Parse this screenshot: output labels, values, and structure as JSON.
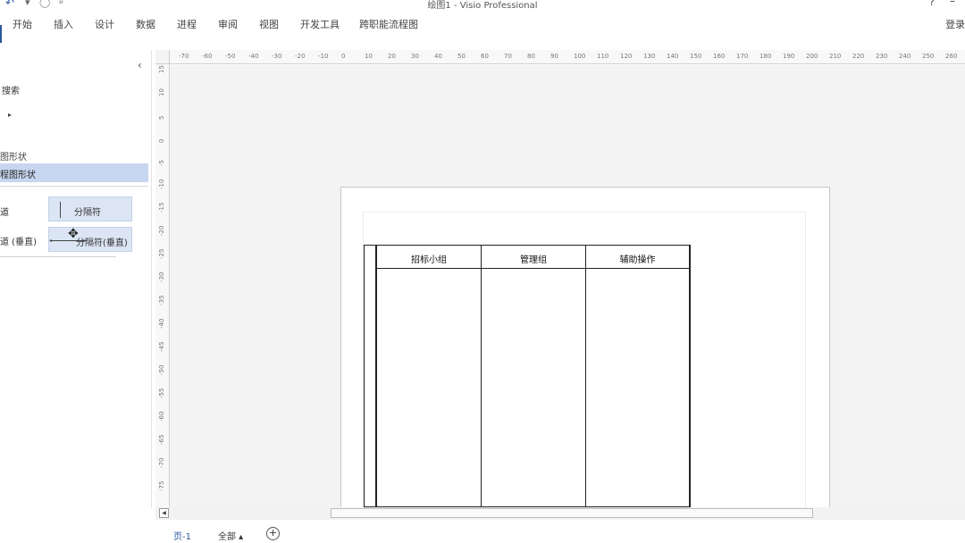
{
  "title_bar": {
    "undo_icon": "↶",
    "dropdown_icon": "▾",
    "circle_icon": "◯",
    "customize_icon": "⇩",
    "title": "绘图1 - Visio Professional",
    "help": "?",
    "minimize": "–"
  },
  "ribbon": {
    "tabs": [
      "开始",
      "插入",
      "设计",
      "数据",
      "进程",
      "审阅",
      "视图",
      "开发工具",
      "跨职能流程图"
    ],
    "signin": "登录"
  },
  "shapes_panel": {
    "collapse_icon": "‹",
    "search_label": "搜索",
    "expand_icon": "▸",
    "stencil_sub": "图形状",
    "stencil_active": "程图形状",
    "frag1": "道",
    "frag2": "道 (垂直)",
    "btn_separator": "分隔符",
    "btn_separator_vertical": "分隔符(垂直)"
  },
  "rulers": {
    "horizontal": [
      "-70",
      "-60",
      "-50",
      "-40",
      "-30",
      "-20",
      "-10",
      "0",
      "10",
      "20",
      "30",
      "40",
      "50",
      "60",
      "70",
      "80",
      "90",
      "100",
      "110",
      "120",
      "130",
      "140",
      "150",
      "160",
      "170",
      "180",
      "190",
      "200",
      "210",
      "220",
      "230",
      "240",
      "250",
      "260"
    ],
    "vertical": [
      "15",
      "10",
      "5",
      "0",
      "-5",
      "-10",
      "-15",
      "-20",
      "-25",
      "-30",
      "-35",
      "-40",
      "-45",
      "-50",
      "-55",
      "-60",
      "-65",
      "-70",
      "-75"
    ]
  },
  "diagram": {
    "lanes": [
      "招标小组",
      "管理组",
      "辅助操作"
    ]
  },
  "page_tabs": {
    "page": "页-1",
    "all": "全部 ▴",
    "add": "+"
  }
}
